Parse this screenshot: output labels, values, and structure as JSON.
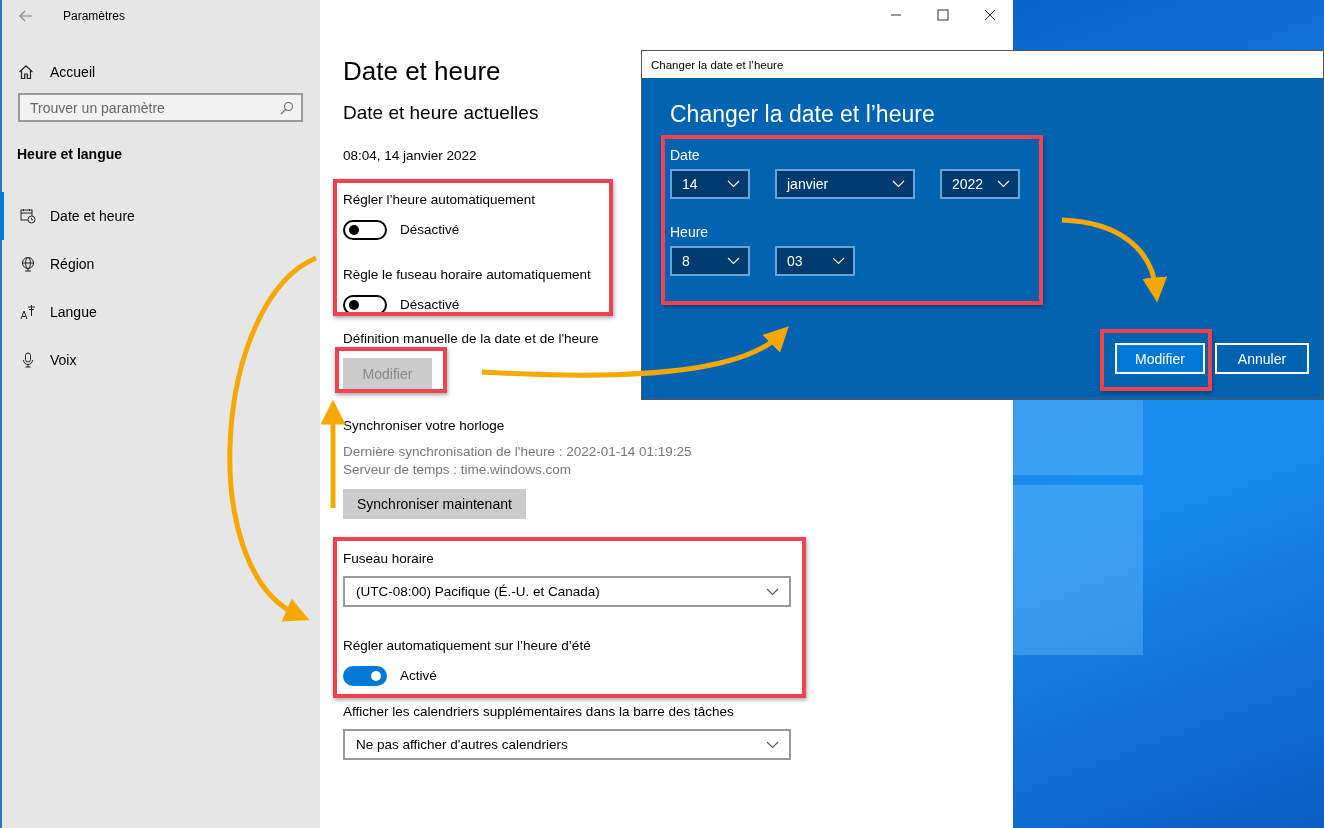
{
  "window": {
    "title": "Paramètres"
  },
  "sidebar": {
    "home": "Accueil",
    "search": {
      "placeholder": "Trouver un paramètre"
    },
    "section": "Heure et langue",
    "items": [
      {
        "label": "Date et heure",
        "selected": true
      },
      {
        "label": "Région",
        "selected": false
      },
      {
        "label": "Langue",
        "selected": false
      },
      {
        "label": "Voix",
        "selected": false
      }
    ]
  },
  "main": {
    "title": "Date et heure",
    "subtitle": "Date et heure actuelles",
    "current": "08:04, 14 janvier 2022",
    "auto_time": {
      "label": "Régler l’heure automatiquement",
      "on": false,
      "state": "Désactivé"
    },
    "auto_zone": {
      "label": "Règle le fuseau horaire automatiquement",
      "on": false,
      "state": "Désactivé"
    },
    "manual": {
      "label": "Définition manuelle de la date et de l'heure",
      "button": {
        "label": "Modifier",
        "disabled": true
      }
    },
    "sync": {
      "heading": "Synchroniser votre horloge",
      "last_sync": "Dernière synchronisation de l'heure : 2022-01-14 01:19:25",
      "server": "Serveur de temps : time.windows.com",
      "button": {
        "label": "Synchroniser maintenant",
        "disabled": false
      }
    },
    "time_zone": {
      "label": "Fuseau horaire",
      "value": "(UTC-08:00) Pacifique (É.-U. et Canada)"
    },
    "dst": {
      "label": "Régler automatiquement sur l’heure d’été",
      "on": true,
      "state": "Activé"
    },
    "calendars": {
      "label": "Afficher les calendriers supplémentaires dans la barre des tâches",
      "value": "Ne pas afficher d'autres calendriers"
    }
  },
  "dialog": {
    "title": "Changer la date et l’heure",
    "heading": "Changer la date et l’heure",
    "date_label": "Date",
    "date_fields": [
      "14",
      "janvier",
      "2022"
    ],
    "time_label": "Heure",
    "time_fields": [
      "8",
      "03"
    ],
    "buttons": [
      {
        "label": "Modifier",
        "primary": true
      },
      {
        "label": "Annuler",
        "primary": false
      }
    ]
  }
}
